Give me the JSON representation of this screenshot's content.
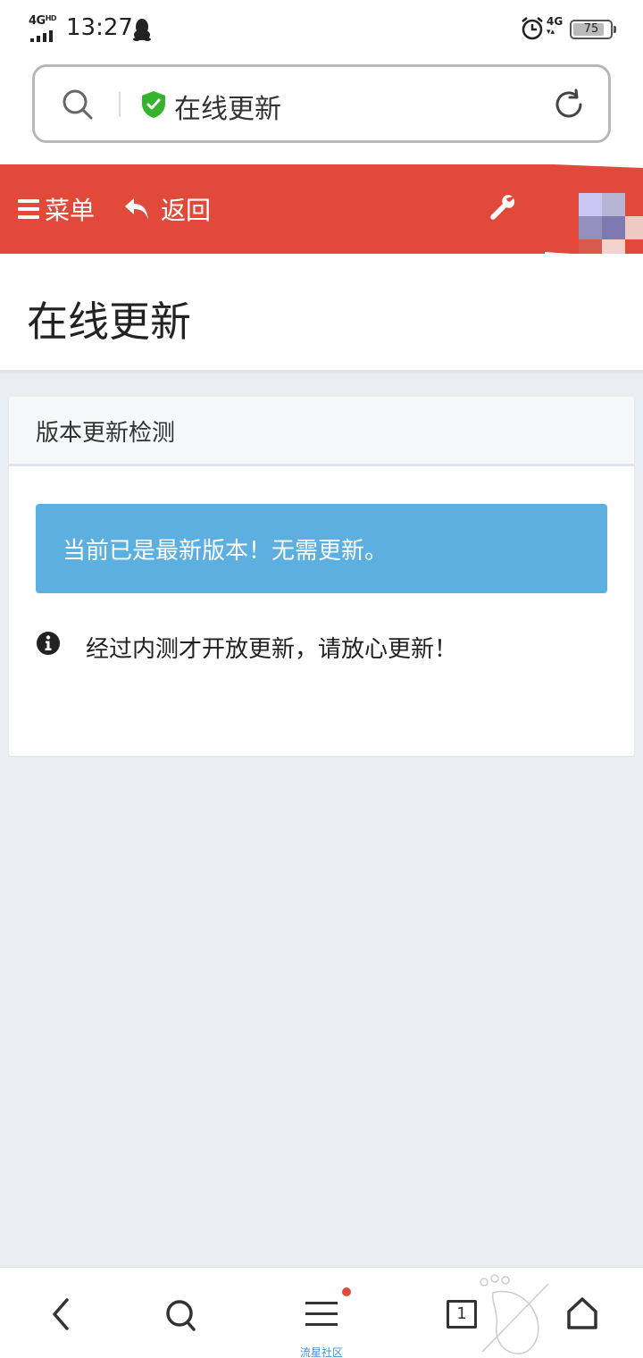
{
  "status_bar": {
    "network": "4G",
    "network_hd": "HD",
    "time": "13:27",
    "mobile_data": "4G",
    "battery": "75"
  },
  "address_bar": {
    "title": "在线更新",
    "icons": [
      "search-icon",
      "shield-check-icon",
      "reload-icon"
    ]
  },
  "navbar": {
    "menu_label": "菜单",
    "back_label": "返回",
    "icons": [
      "hamburger-icon",
      "undo-arrow-icon",
      "wrench-icon"
    ],
    "color": "#e14a3a"
  },
  "page": {
    "title": "在线更新"
  },
  "card": {
    "header": "版本更新检测",
    "alert": "当前已是最新版本！无需更新。",
    "alert_color": "#5dafe0",
    "info": "经过内测才开放更新，请放心更新！"
  },
  "bottom_nav": {
    "menu_label": "流星社区",
    "tab_count": "1",
    "icons": [
      "back-icon",
      "search-icon",
      "menu-icon",
      "tabs-icon",
      "home-icon"
    ]
  }
}
